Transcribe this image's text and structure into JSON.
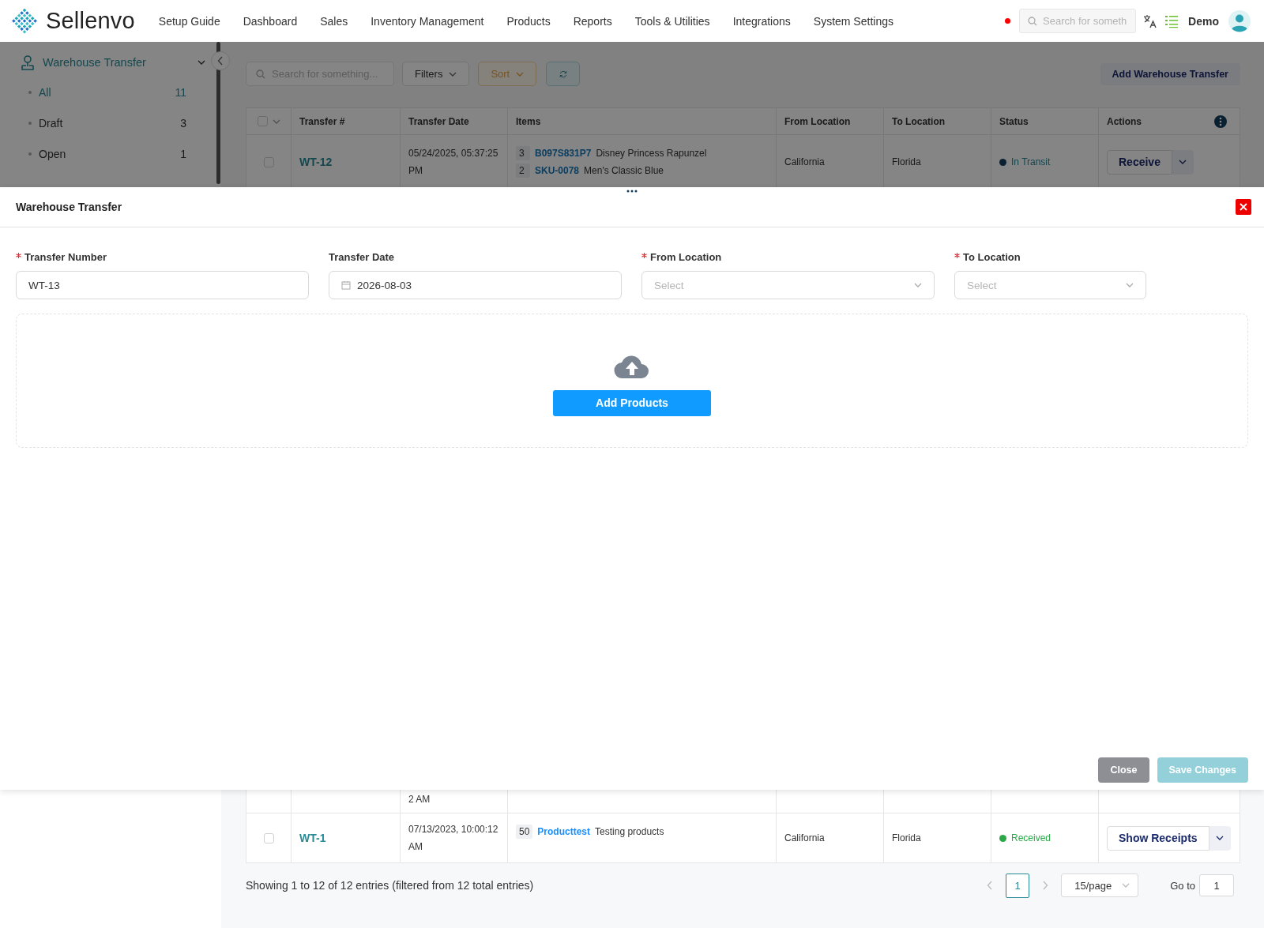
{
  "brand": "Sellenvo",
  "nav": {
    "items": [
      "Setup Guide",
      "Dashboard",
      "Sales",
      "Inventory Management",
      "Products",
      "Reports",
      "Tools & Utilities",
      "Integrations",
      "System Settings"
    ],
    "search_placeholder": "Search for someth",
    "user": "Demo"
  },
  "sidebar": {
    "title": "Warehouse Transfer",
    "items": [
      {
        "label": "All",
        "count": "11",
        "selected": true
      },
      {
        "label": "Draft",
        "count": "3",
        "selected": false
      },
      {
        "label": "Open",
        "count": "1",
        "selected": false
      }
    ]
  },
  "toolbar": {
    "search_placeholder": "Search for something...",
    "filters": "Filters",
    "sort": "Sort",
    "add_button": "Add Warehouse Transfer"
  },
  "table": {
    "select_all_checked": false,
    "columns": [
      "Transfer #",
      "Transfer Date",
      "Items",
      "From Location",
      "To Location",
      "Status",
      "Actions"
    ],
    "rows": [
      {
        "kind": "full",
        "checked": false,
        "transfer": "WT-12",
        "date": "05/24/2025, 05:37:25 PM",
        "items": [
          {
            "qty": "3",
            "sku": "B097S831P7",
            "name": "Disney Princess Rapunzel"
          },
          {
            "qty": "2",
            "sku": "SKU-0078",
            "name": "Men's Classic Blue"
          }
        ],
        "from": "California",
        "to": "Florida",
        "status": {
          "kind": "transit",
          "label": "In Transit",
          "color": "#0a2131"
        },
        "action": "Receive"
      },
      {
        "kind": "partial",
        "date": "2 AM"
      },
      {
        "kind": "full",
        "checked": false,
        "transfer": "WT-1",
        "date": "07/13/2023, 10:00:12 AM",
        "items": [
          {
            "qty": "50",
            "sku": "Producttest",
            "name": "Testing products"
          }
        ],
        "from": "California",
        "to": "Florida",
        "status": {
          "kind": "received",
          "label": "Received",
          "color": "#2ca84a"
        },
        "action": "Show Receipts"
      }
    ]
  },
  "pagination": {
    "summary": "Showing 1 to 12 of 12 entries (filtered from 12 total entries)",
    "pages": [
      {
        "label": "1",
        "selected": true
      }
    ],
    "page_size": "15/page",
    "goto_label": "Go to",
    "goto_value": "1"
  },
  "drawer": {
    "title": "Warehouse Transfer",
    "fields": [
      {
        "kind": "text",
        "label": "Transfer Number",
        "required": true,
        "value": "WT-13"
      },
      {
        "kind": "date",
        "label": "Transfer Date",
        "required": false,
        "value": "2026-08-03"
      },
      {
        "kind": "select",
        "label": "From Location",
        "required": true,
        "placeholder": "Select"
      },
      {
        "kind": "select",
        "label": "To Location",
        "required": true,
        "placeholder": "Select"
      }
    ],
    "add_products": "Add Products",
    "actions": [
      {
        "label": "Close",
        "disabled": false
      },
      {
        "label": "Save Changes",
        "disabled": true
      }
    ]
  }
}
